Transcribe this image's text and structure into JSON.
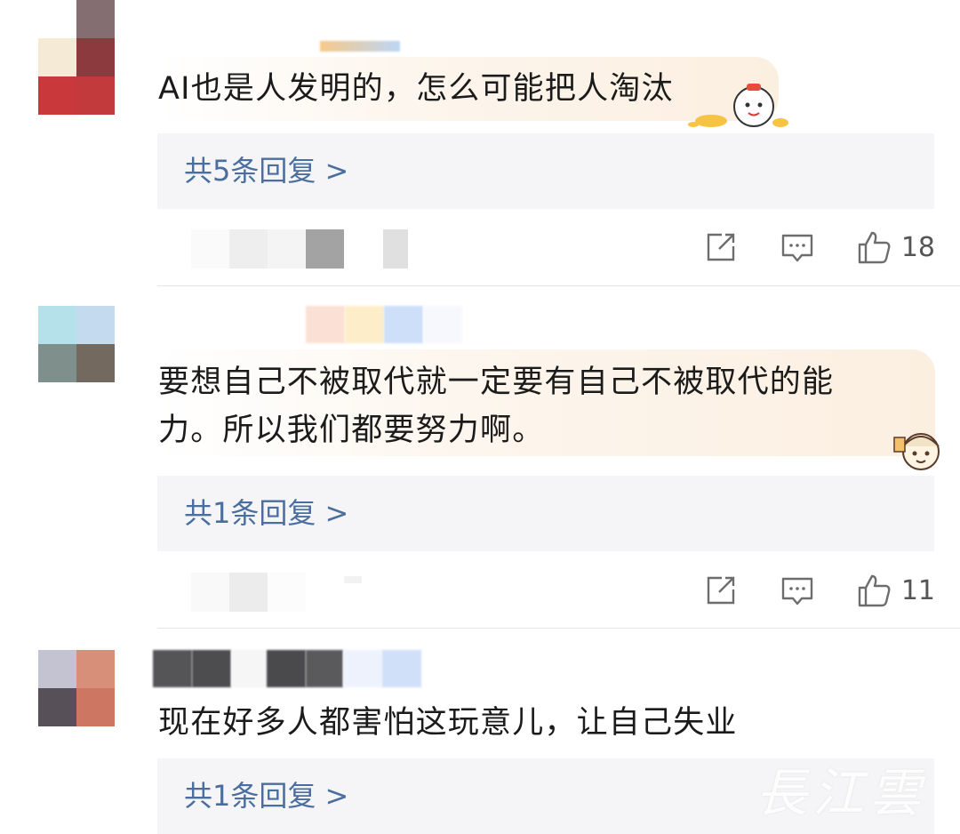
{
  "comments": [
    {
      "text": "AI也是人发明的，怎么可能把人淘汰",
      "reply_label": "共5条回复 >",
      "like_count": "18"
    },
    {
      "text": "要想自己不被取代就一定要有自己不被取代的能力。所以我们都要努力啊。",
      "reply_label": "共1条回复 >",
      "like_count": "11"
    },
    {
      "text": "现在好多人都害怕这玩意儿，让自己失业",
      "reply_label": "共1条回复 >"
    }
  ],
  "watermark": "長江雲",
  "colors": {
    "reply_link": "#4a6e9e",
    "reply_box_bg": "#f5f5f7",
    "bubble_tint": "#fbefe0"
  },
  "icons": [
    "share-icon",
    "comment-icon",
    "like-icon"
  ]
}
